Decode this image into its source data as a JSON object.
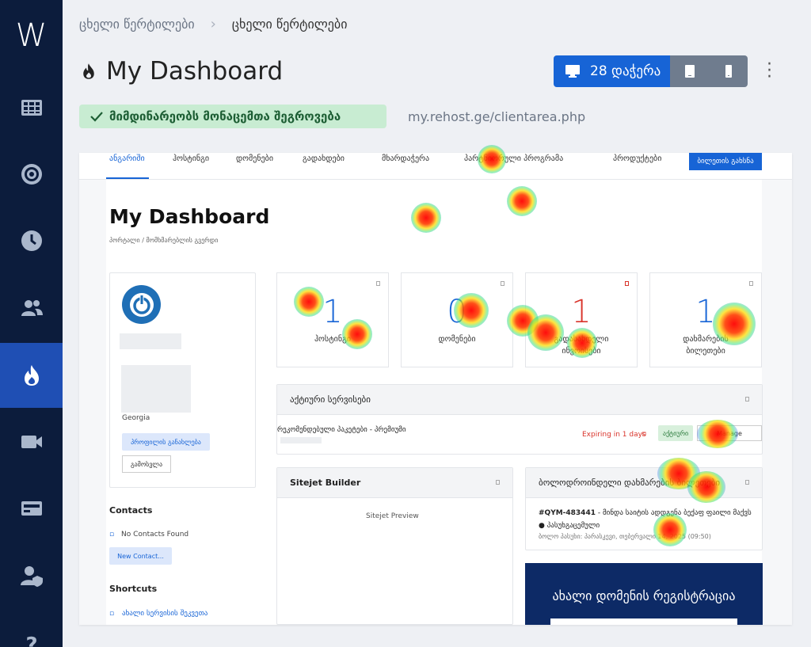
{
  "app": {
    "logo": "W",
    "rail_items": [
      "grid-icon",
      "target-icon",
      "clock-icon",
      "users-icon",
      "flame-icon",
      "video-icon",
      "card-icon",
      "user-shield-icon",
      "help-icon"
    ],
    "active_item": "flame-icon"
  },
  "breadcrumb": {
    "parent": "ცხელი წერტილები",
    "current": "ცხელი წერტილები"
  },
  "page": {
    "title": "My Dashboard",
    "title_icon": "flame-icon"
  },
  "devices": {
    "desktop_label": "28 დაჭერა",
    "desktop_icon": "monitor-icon",
    "tablet_icon": "tablet-icon",
    "mobile_icon": "mobile-icon"
  },
  "status": {
    "text": "მიმდინარეობს მონაცემთა შეგროვება",
    "icon": "check-icon"
  },
  "url": "my.rehost.ge/clientarea.php",
  "preview": {
    "nav": {
      "items": [
        "ანგარიში",
        "ჰოსტინგი",
        "დომენები",
        "გადახდები",
        "მხარდაჭერა",
        "პარტნიორული პროგრამა",
        "პროდუქტები"
      ],
      "active": "ანგარიში",
      "cta": "ბილეთის გახსნა"
    },
    "title": "My Dashboard",
    "crumb": "პორტალი / მომხმარებლის გვერდი",
    "profile": {
      "country": "Georgia",
      "update_button": "პროფილის განახლება",
      "logout_button": "გამოსვლა"
    },
    "contacts": {
      "title": "Contacts",
      "empty": "No Contacts Found",
      "new_button": "New Contact..."
    },
    "shortcuts": {
      "title": "Shortcuts",
      "first": "ახალი სერვისის შეკვეთა"
    },
    "stats": [
      {
        "value": "1",
        "label": "ჰოსტინგი",
        "color": "#1764d6"
      },
      {
        "value": "0",
        "label": "დომენები",
        "color": "#1764d6"
      },
      {
        "value": "1",
        "label": "გადასახდელი ინვოისები",
        "color": "#d9342b"
      },
      {
        "value": "1",
        "label": "დახმარების ბილეთები",
        "color": "#1764d6"
      }
    ],
    "active_services": {
      "title": "აქტიური სერვისები",
      "row_name": "რეკომენდებული პაკეტები - პრემიუმი",
      "expiring": "Expiring in 1 days",
      "status": "აქტიური",
      "manage": "Manage"
    },
    "sitejet": {
      "title": "Sitejet Builder",
      "preview_alt": "Sitejet Preview"
    },
    "recent_tickets": {
      "title": "ბოლოდროინდელი დახმარების ბილეთები",
      "ticket_id": "#QYM-483441",
      "ticket_subject": " - მინდა საიტის ადდგენა ბექაფ ფაილი მაქვს",
      "ticket_status": "პასუხგაცემული",
      "last_reply": "ბოლო პასუხი: პარასკევი, თებერვალი 14, 2025 (09:50)"
    },
    "domain_register": {
      "title": "ახალი დომენის რეგისტრაცია"
    }
  }
}
